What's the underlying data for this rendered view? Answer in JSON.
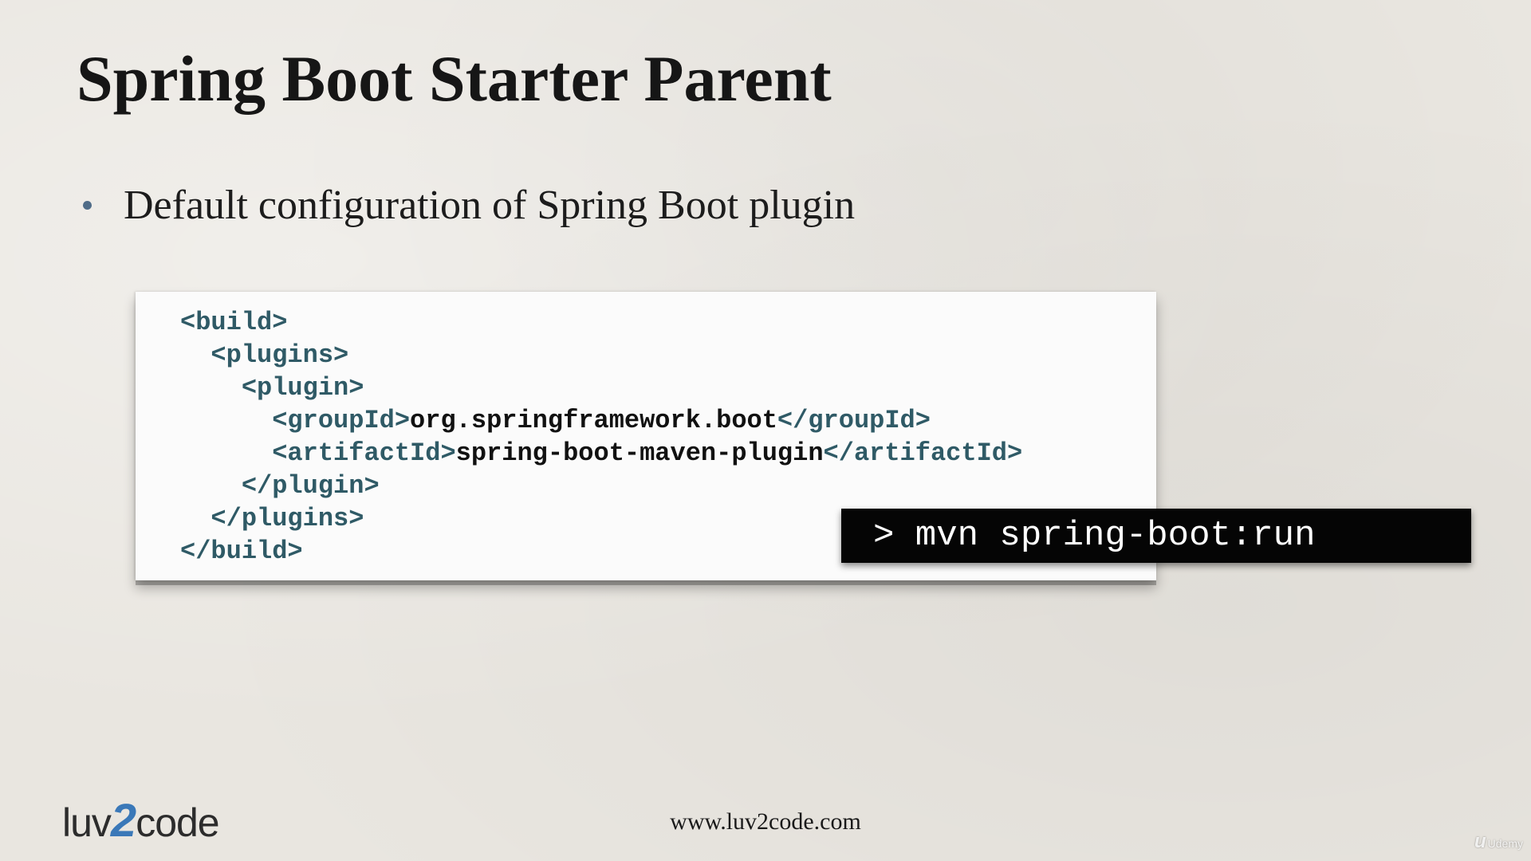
{
  "slide": {
    "title": "Spring Boot Starter Parent",
    "bullets": [
      "Default configuration of Spring Boot plugin"
    ]
  },
  "code": {
    "lines": [
      {
        "indent": "",
        "open": "<build>",
        "value": "",
        "close": ""
      },
      {
        "indent": "  ",
        "open": "<plugins>",
        "value": "",
        "close": ""
      },
      {
        "indent": "    ",
        "open": "<plugin>",
        "value": "",
        "close": ""
      },
      {
        "indent": "      ",
        "open": "<groupId>",
        "value": "org.springframework.boot",
        "close": "</groupId>"
      },
      {
        "indent": "      ",
        "open": "<artifactId>",
        "value": "spring-boot-maven-plugin",
        "close": "</artifactId>"
      },
      {
        "indent": "    ",
        "open": "</plugin>",
        "value": "",
        "close": ""
      },
      {
        "indent": "  ",
        "open": "</plugins>",
        "value": "",
        "close": ""
      },
      {
        "indent": "",
        "open": "</build>",
        "value": "",
        "close": ""
      }
    ]
  },
  "command": {
    "text": "> mvn spring-boot:run"
  },
  "footer": {
    "logo_left": "luv",
    "logo_mid": "2",
    "logo_right": "code",
    "url": "www.luv2code.com"
  },
  "watermark": {
    "mark": "u",
    "text": "Udemy"
  },
  "colors": {
    "background": "#e9e6e0",
    "tag": "#2f5a66",
    "bullet": "#506c88",
    "command_bg": "#050505",
    "logo_accent": "#3a78b8"
  }
}
